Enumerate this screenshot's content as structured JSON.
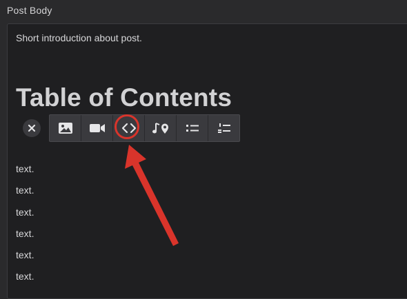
{
  "field": {
    "label": "Post Body"
  },
  "editor": {
    "intro": "Short introduction about post.",
    "heading": "Table of Contents",
    "lines": [
      "text.",
      "text.",
      "text.",
      "text.",
      "text.",
      "text."
    ]
  },
  "toolbar": {
    "close_icon": "close-icon",
    "buttons": [
      "image-icon",
      "video-icon",
      "code-icon",
      "audio-location-icon",
      "bullet-list-icon",
      "numbered-list-icon"
    ],
    "highlighted": "code-icon"
  },
  "colors": {
    "annotation": "#d9342b",
    "background": "#1f1f21",
    "toolbar": "#3a3a3e",
    "text": "#d8d8da"
  }
}
